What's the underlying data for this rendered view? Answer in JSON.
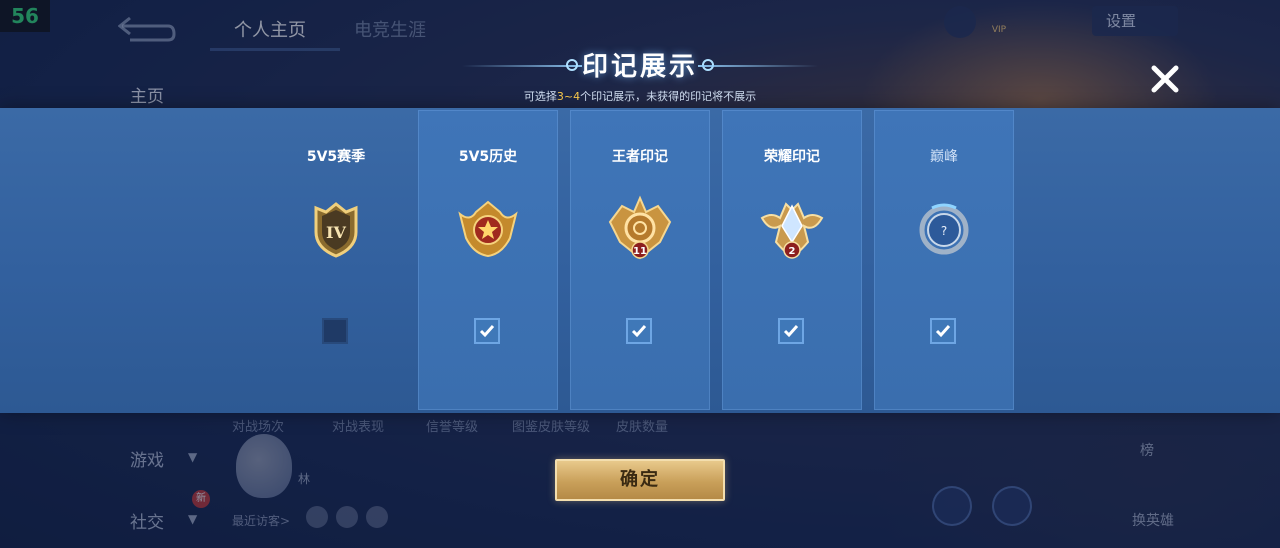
{
  "fps": "56",
  "background": {
    "tabs": [
      "个人主页",
      "电竞生涯"
    ],
    "sidebar": {
      "home": "主页",
      "game": "游戏",
      "social": "社交"
    },
    "new_badge": "新",
    "settings": "设置",
    "stats_labels": [
      "对战场次",
      "对战表现",
      "信誉等级",
      "图鉴皮肤等级",
      "皮肤数量"
    ],
    "mascot_name": "林",
    "recent_visitors": "最近访客>",
    "right_bottom": {
      "top": "榜",
      "bottom": "换英雄"
    }
  },
  "modal": {
    "title": "印记展示",
    "subtitle": {
      "prefix": "可选择",
      "highlight": "3~4",
      "suffix": "个印记展示，未获得的印记将不展示"
    },
    "close_icon": "close-icon",
    "cards": [
      {
        "label": "5V5赛季",
        "badge": "season-shield-badge",
        "badge_text": "IV",
        "checked": false
      },
      {
        "label": "5V5历史",
        "badge": "history-star-badge",
        "checked": true
      },
      {
        "label": "王者印记",
        "badge": "king-mark-badge",
        "badge_text": "11",
        "checked": true
      },
      {
        "label": "荣耀印记",
        "badge": "glory-mark-badge",
        "badge_text": "2",
        "checked": true
      },
      {
        "label": "巅峰",
        "badge": "peak-locked-badge",
        "badge_text": "?",
        "checked": true
      }
    ],
    "confirm": "确定"
  },
  "colors": {
    "accent_gold": "#c9a05a",
    "highlight": "#ffce4d",
    "panel": "#3b6aa6"
  }
}
